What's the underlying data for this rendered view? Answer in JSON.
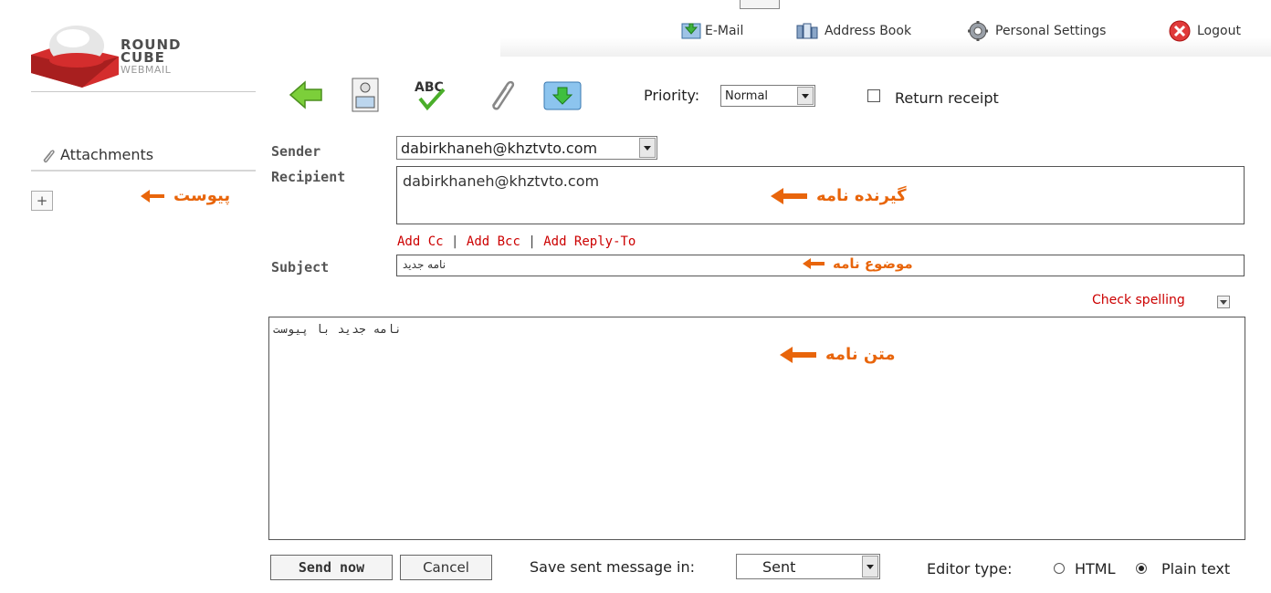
{
  "nav": {
    "email": "E-Mail",
    "address_book": "Address Book",
    "personal_settings": "Personal Settings",
    "logout": "Logout"
  },
  "logo": {
    "line1": "ROUND",
    "line2": "CUBE",
    "line3": "WEBMAIL"
  },
  "toolbar": {
    "priority_label": "Priority:",
    "priority_value": "Normal",
    "return_receipt_label": "Return receipt",
    "return_receipt_checked": false
  },
  "sidebar": {
    "attachments_title": "Attachments",
    "attach_annotation": "پیوست"
  },
  "form": {
    "sender_label": "Sender",
    "sender_value": "dabirkhaneh@khztvto.com",
    "recipient_label": "Recipient",
    "recipient_value": "dabirkhaneh@khztvto.com",
    "recipient_annotation": "گیرنده نامه",
    "add_cc": "Add Cc",
    "add_bcc": "Add Bcc",
    "add_reply_to": "Add Reply-To",
    "separator": "|",
    "subject_label": "Subject",
    "subject_value": "نامه جدید",
    "subject_annotation": "موضوع نامه",
    "check_spelling": "Check spelling",
    "body_value": "نامه جدید با پیوست",
    "body_annotation": "متن نامه"
  },
  "footer": {
    "send_now": "Send now",
    "cancel": "Cancel",
    "save_sent_label": "Save sent message in:",
    "save_sent_value": "Sent",
    "editor_type_label": "Editor type:",
    "editor_html": "HTML",
    "editor_plain": "Plain text",
    "editor_selected": "Plain text"
  },
  "colors": {
    "annotation": "#e8650b",
    "link_red": "#cc0000",
    "logo_red": "#d42d2d"
  }
}
